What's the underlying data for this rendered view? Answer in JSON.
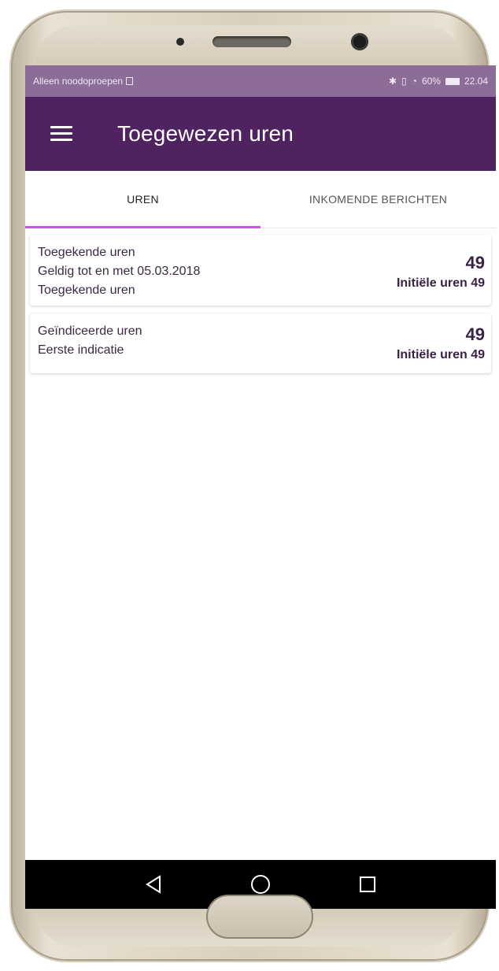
{
  "status_bar": {
    "left_text": "Alleen noodoproepen",
    "battery": "60%",
    "time": "22.04"
  },
  "app_bar": {
    "title": "Toegewezen uren",
    "menu_icon": "hamburger-menu-icon"
  },
  "tabs": [
    {
      "label": "UREN",
      "active": true
    },
    {
      "label": "INKOMENDE BERICHTEN",
      "active": false
    }
  ],
  "cards": [
    {
      "lines": [
        "Toegekende uren",
        "Geldig tot en met 05.03.2018",
        "Toegekende uren"
      ],
      "value": "49",
      "initial": "Initiële uren 49"
    },
    {
      "lines": [
        "Geïndiceerde uren",
        "Eerste indicatie"
      ],
      "value": "49",
      "initial": "Initiële uren 49"
    }
  ],
  "nav": {
    "back": "back-triangle-icon",
    "home": "home-circle-icon",
    "recents": "recents-square-icon"
  },
  "colors": {
    "status_bar": "#8c6d98",
    "app_bar": "#4f2260",
    "tab_indicator": "#c657e6",
    "value_text": "#3a2246"
  }
}
